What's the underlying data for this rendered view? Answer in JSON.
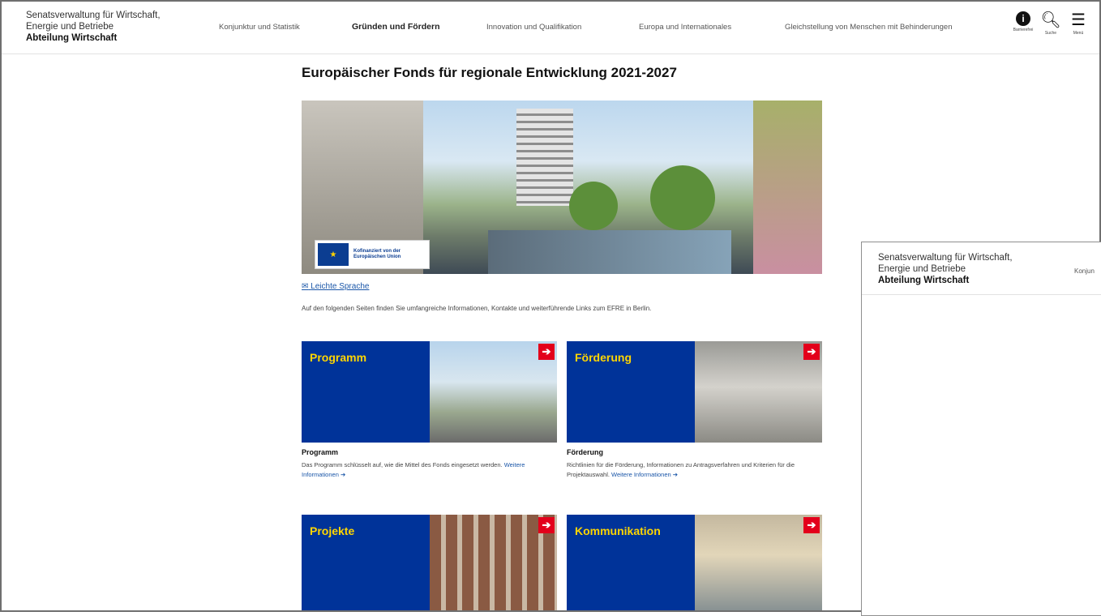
{
  "header": {
    "org_line1": "Senatsverwaltung für Wirtschaft,",
    "org_line2": "Energie und Betriebe",
    "org_line3": "Abteilung Wirtschaft",
    "nav": [
      "Konjunktur und Statistik",
      "Gründen und Fördern",
      "Innovation und Qualifikation",
      "Europa und Internationales",
      "Gleichstellung von Menschen mit Behinderungen"
    ],
    "tools": [
      {
        "label": "Barrierefrei",
        "icon": "accessibility-icon"
      },
      {
        "label": "Suche",
        "icon": "search-icon"
      },
      {
        "label": "Menü",
        "icon": "menu-icon"
      }
    ]
  },
  "page": {
    "title": "Europäischer Fonds für regionale Entwicklung 2021-2027",
    "eu_badge_line1": "Kofinanziert von der",
    "eu_badge_line2": "Europäischen Union",
    "easy_language": "Leichte Sprache",
    "intro": "Auf den folgenden Seiten finden Sie umfangreiche Informationen, Kontakte und weiterführende Links zum EFRE in Berlin."
  },
  "cards": [
    {
      "image_label": "Programm",
      "title": "Programm",
      "desc": "Das Programm schlüsselt auf, wie die Mittel des Fonds eingesetzt werden.",
      "more": "Weitere Informationen"
    },
    {
      "image_label": "Förderung",
      "title": "Förderung",
      "desc": "Richtlinien für die Förderung, Informationen zu Antragsverfahren und Kriterien für die Projektauswahl.",
      "more": "Weitere Informationen"
    },
    {
      "image_label": "Projekte"
    },
    {
      "image_label": "Kommunikation"
    }
  ],
  "second_window": {
    "org_line1": "Senatsverwaltung für Wirtschaft,",
    "org_line2": "Energie und Betriebe",
    "org_line3": "Abteilung Wirtschaft",
    "nav_cut": "Konjun"
  }
}
